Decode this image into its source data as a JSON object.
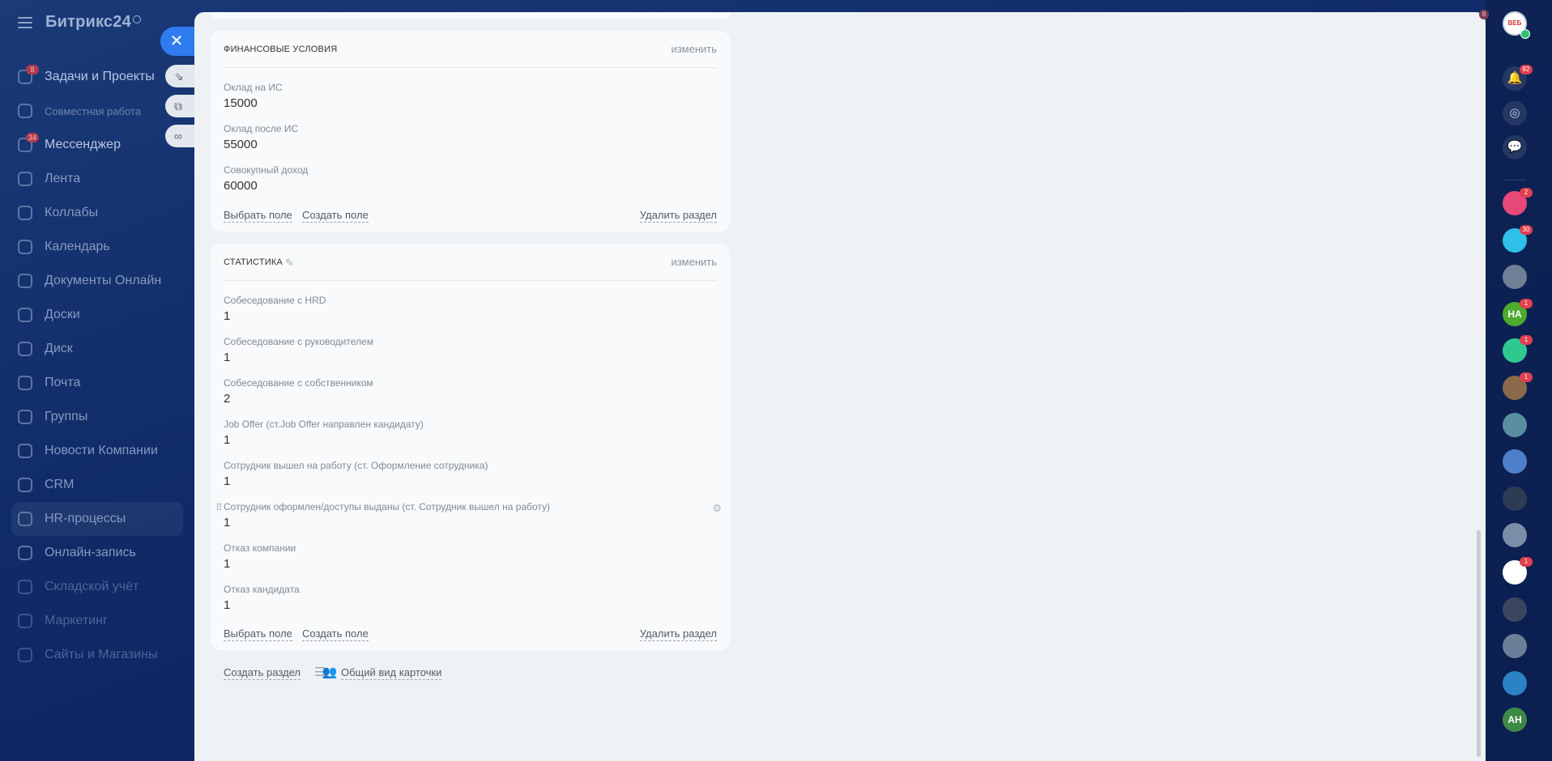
{
  "sidebar": {
    "logo": "Битрикс24",
    "items": [
      {
        "label": "Задачи и Проекты",
        "badge": "8",
        "style": "bright"
      },
      {
        "label": "Совместная работа",
        "badge": "",
        "style": "small"
      },
      {
        "label": "Мессенджер",
        "badge": "34",
        "style": "bright"
      },
      {
        "label": "Лента",
        "badge": "",
        "style": ""
      },
      {
        "label": "Коллабы",
        "badge": "",
        "style": ""
      },
      {
        "label": "Календарь",
        "badge": "",
        "style": ""
      },
      {
        "label": "Документы Онлайн",
        "badge": "",
        "style": ""
      },
      {
        "label": "Доски",
        "badge": "",
        "style": ""
      },
      {
        "label": "Диск",
        "badge": "",
        "style": ""
      },
      {
        "label": "Почта",
        "badge": "",
        "style": ""
      },
      {
        "label": "Группы",
        "badge": "",
        "style": ""
      },
      {
        "label": "Новости Компании",
        "badge": "",
        "style": ""
      },
      {
        "label": "CRM",
        "badge": "",
        "style": ""
      },
      {
        "label": "HR-процессы",
        "badge": "",
        "style": "active"
      },
      {
        "label": "Онлайн-запись",
        "badge": "",
        "style": ""
      },
      {
        "label": "Складской учёт",
        "badge": "",
        "style": "faint"
      },
      {
        "label": "Маркетинг",
        "badge": "",
        "style": "faint"
      },
      {
        "label": "Сайты и Магазины",
        "badge": "",
        "style": "faint"
      }
    ]
  },
  "finance": {
    "title": "ФИНАНСОВЫЕ УСЛОВИЯ",
    "edit": "изменить",
    "fields": [
      {
        "label": "Оклад на ИС",
        "value": "15000"
      },
      {
        "label": "Оклад после ИС",
        "value": "55000"
      },
      {
        "label": "Совокупный доход",
        "value": "60000"
      }
    ],
    "choose_field": "Выбрать поле",
    "create_field": "Создать поле",
    "delete_section": "Удалить раздел"
  },
  "stats": {
    "title": "СТАТИСТИКА",
    "edit": "изменить",
    "fields": [
      {
        "label": "Собеседование с HRD",
        "value": "1"
      },
      {
        "label": "Собеседование с руководителем",
        "value": "1"
      },
      {
        "label": "Собеседование с собственником",
        "value": "2"
      },
      {
        "label": "Job Offer (ст.Job Offer направлен кандидату)",
        "value": "1"
      },
      {
        "label": "Сотрудник вышел на работу (ст. Оформление сотрудника)",
        "value": "1"
      },
      {
        "label": "Сотрудник оформлен/доступы выданы (ст. Сотрудник вышел на работу)",
        "value": "1"
      },
      {
        "label": "Отказ компании",
        "value": "1"
      },
      {
        "label": "Отказ кандидата",
        "value": "1"
      }
    ],
    "choose_field": "Выбрать поле",
    "create_field": "Создать поле",
    "delete_section": "Удалить раздел"
  },
  "bottom": {
    "create_section": "Создать раздел",
    "common_view": "Общий вид карточки"
  },
  "rail": {
    "top_badge": "8",
    "notifications_badge": "82",
    "avatars": [
      {
        "initials": "",
        "color": "#e8477a",
        "badge": "2"
      },
      {
        "initials": "",
        "color": "#2fc0e8",
        "badge": "30"
      },
      {
        "initials": "",
        "color": "#6f7f95",
        "badge": ""
      },
      {
        "initials": "НА",
        "color": "#4caa2e",
        "badge": "1"
      },
      {
        "initials": "",
        "color": "#2ec98f",
        "badge": "1"
      },
      {
        "initials": "",
        "color": "#8a6a4a",
        "badge": "1"
      },
      {
        "initials": "",
        "color": "#5a8fa0",
        "badge": ""
      },
      {
        "initials": "",
        "color": "#4f7fc9",
        "badge": ""
      },
      {
        "initials": "",
        "color": "#2e3b55",
        "badge": ""
      },
      {
        "initials": "",
        "color": "#7a8ea8",
        "badge": ""
      },
      {
        "initials": "",
        "color": "#ffffff",
        "badge": "1"
      },
      {
        "initials": "",
        "color": "#3a4660",
        "badge": ""
      },
      {
        "initials": "",
        "color": "#6b7f98",
        "badge": ""
      },
      {
        "initials": "",
        "color": "#2b82c4",
        "badge": ""
      },
      {
        "initials": "АН",
        "color": "#3d8a46",
        "badge": ""
      }
    ]
  }
}
